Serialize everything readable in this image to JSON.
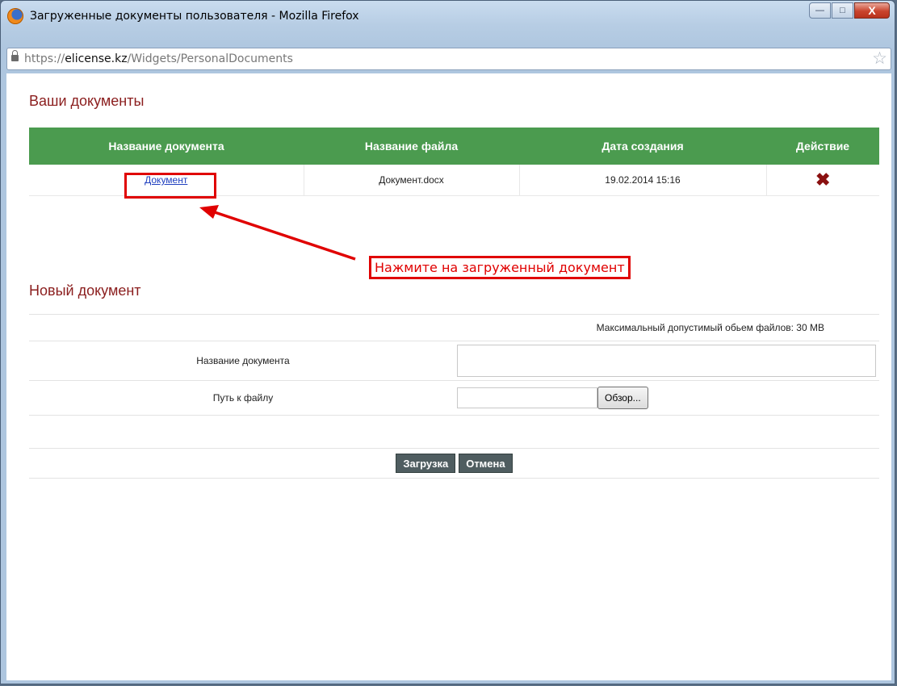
{
  "window": {
    "title": "Загруженные документы пользователя - Mozilla Firefox",
    "controls": {
      "minimize": "—",
      "maximize": "□",
      "close": "X"
    }
  },
  "address": {
    "scheme": "https://",
    "host": "elicense.kz",
    "path": "/Widgets/PersonalDocuments"
  },
  "your_documents": {
    "heading": "Ваши документы",
    "columns": [
      "Название документа",
      "Название файла",
      "Дата создания",
      "Действие"
    ],
    "rows": [
      {
        "doc_name": "Документ",
        "file_name": "Документ.docx",
        "created": "19.02.2014 15:16",
        "action": "✖"
      }
    ]
  },
  "annotation": {
    "text": "Нажмите на загруженный документ",
    "color": "#e00000"
  },
  "new_document": {
    "heading": "Новый документ",
    "max_size": "Максимальный допустимый обьем файлов: 30 MB",
    "name_label": "Название документа",
    "name_value": "",
    "path_label": "Путь к файлу",
    "path_value": "",
    "browse_label": "Обзор..."
  },
  "actions": {
    "upload": "Загрузка",
    "cancel": "Отмена"
  },
  "colors": {
    "header_green": "#4b9b4f",
    "heading_red": "#8b1e1e",
    "button_dark": "#4f5d60"
  }
}
